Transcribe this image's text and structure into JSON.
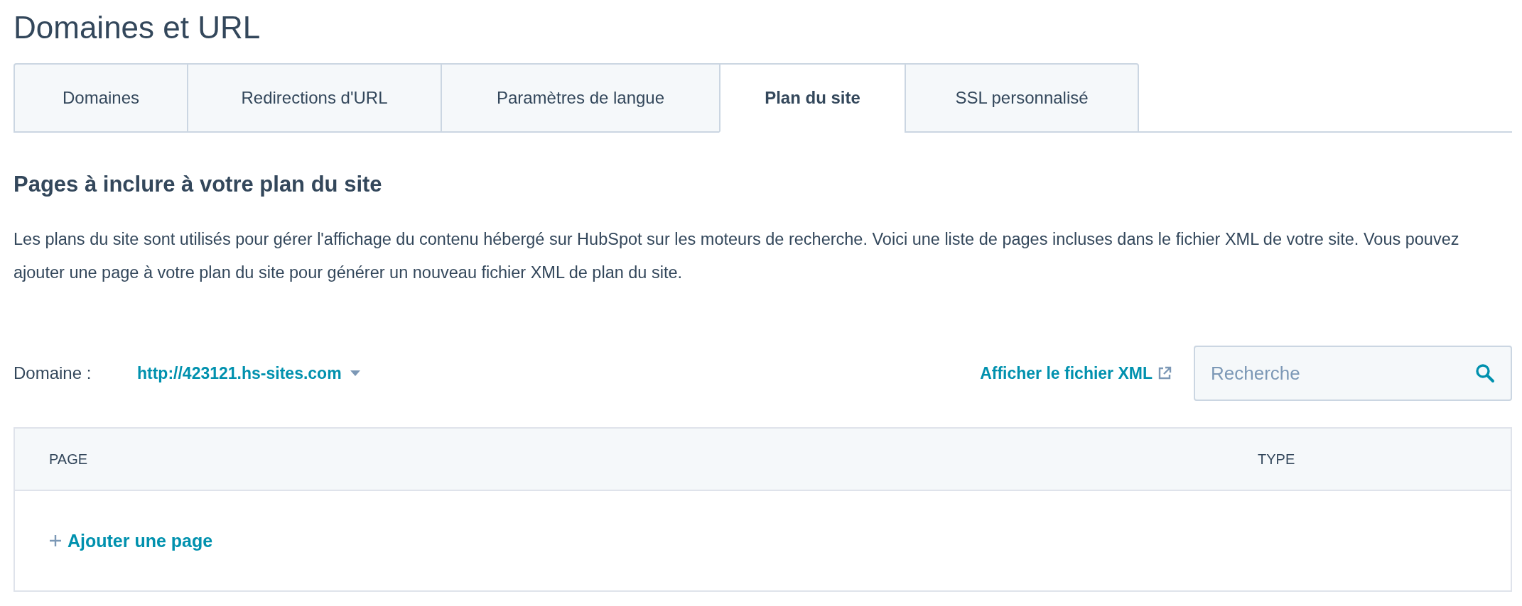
{
  "title": "Domaines et URL",
  "tabs": [
    {
      "label": "Domaines",
      "selected": false
    },
    {
      "label": "Redirections d'URL",
      "selected": false
    },
    {
      "label": "Paramètres de langue",
      "selected": false
    },
    {
      "label": "Plan du site",
      "selected": true
    },
    {
      "label": "SSL personnalisé",
      "selected": false
    }
  ],
  "section": {
    "heading": "Pages à inclure à votre plan du site",
    "description": "Les plans du site sont utilisés pour gérer l'affichage du contenu hébergé sur HubSpot sur les moteurs de recherche. Voici une liste de pages incluses dans le fichier XML de votre site. Vous pouvez ajouter une page à votre plan du site pour générer un nouveau fichier XML de plan du site."
  },
  "domain": {
    "label": "Domaine :",
    "value": "http://423121.hs-sites.com"
  },
  "xml_link": "Afficher le fichier XML",
  "search": {
    "placeholder": "Recherche"
  },
  "table": {
    "columns": [
      "PAGE",
      "TYPE"
    ],
    "add_link": "Ajouter une page"
  }
}
